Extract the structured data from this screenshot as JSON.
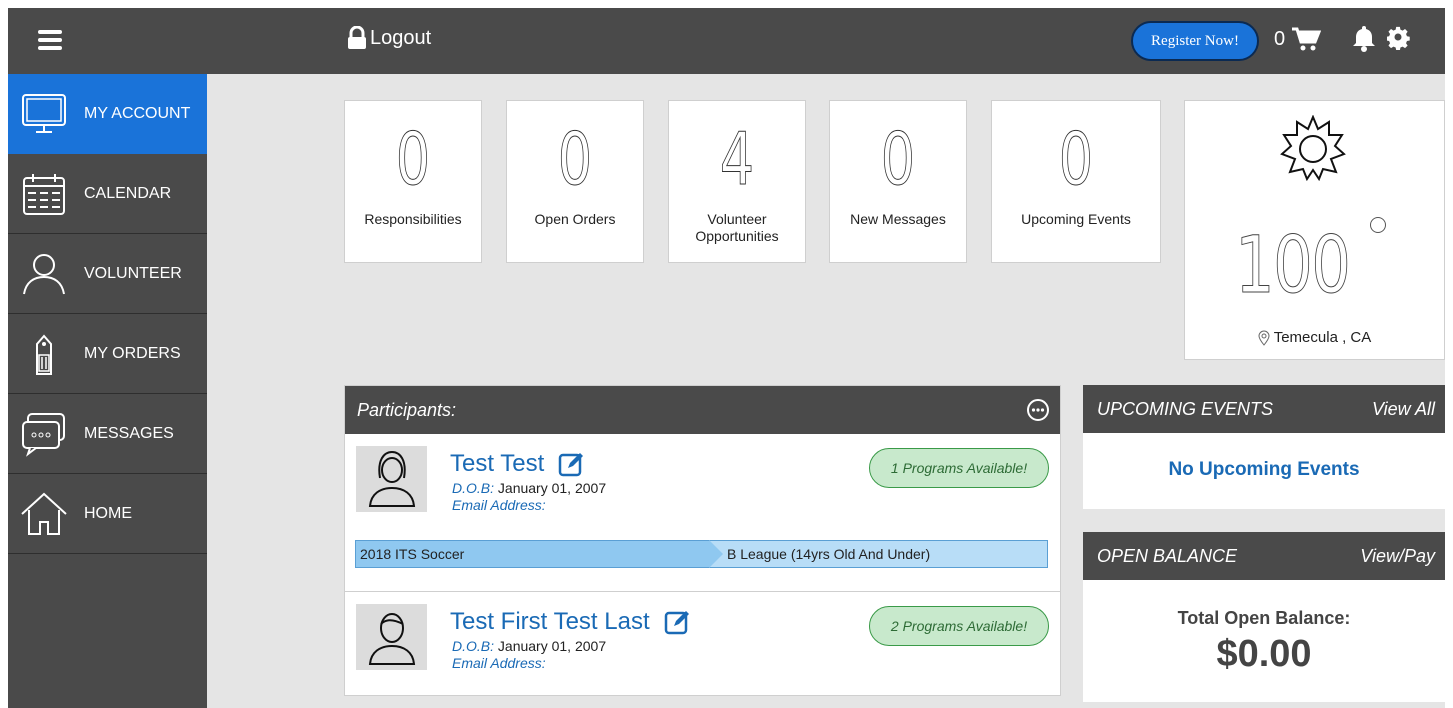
{
  "header": {
    "logout_label": "Logout",
    "register_label": "Register Now!",
    "cart_count": "0"
  },
  "sidebar": {
    "items": [
      {
        "label": "MY ACCOUNT",
        "icon": "monitor-icon",
        "active": true
      },
      {
        "label": "CALENDAR",
        "icon": "calendar-icon"
      },
      {
        "label": "VOLUNTEER",
        "icon": "person-icon"
      },
      {
        "label": "MY ORDERS",
        "icon": "tag-icon"
      },
      {
        "label": "MESSAGES",
        "icon": "chat-icon"
      },
      {
        "label": "HOME",
        "icon": "home-icon"
      }
    ]
  },
  "stats": [
    {
      "value": "0",
      "label": "Responsibilities"
    },
    {
      "value": "0",
      "label": "Open Orders"
    },
    {
      "value": "4",
      "label": "Volunteer Opportunities"
    },
    {
      "value": "0",
      "label": "New Messages"
    },
    {
      "value": "0",
      "label": "Upcoming Events"
    }
  ],
  "weather": {
    "temperature": "100",
    "location": "Temecula , CA",
    "icon": "sun-icon"
  },
  "participants": {
    "title": "Participants:",
    "list": [
      {
        "name": "Test Test",
        "dob_label": "D.O.B:",
        "dob": "January 01, 2007",
        "email_label": "Email Address:",
        "programs": "1 Programs Available!",
        "program_name": "2018 ITS Soccer",
        "division": "B League (14yrs Old And Under)"
      },
      {
        "name": "Test First Test Last",
        "dob_label": "D.O.B:",
        "dob": "January 01, 2007",
        "email_label": "Email Address:",
        "programs": "2 Programs Available!"
      }
    ]
  },
  "upcoming_events": {
    "title": "UPCOMING EVENTS",
    "link": "View All",
    "empty": "No Upcoming Events"
  },
  "open_balance": {
    "title": "OPEN BALANCE",
    "link": "View/Pay",
    "label": "Total Open Balance:",
    "value": "$0.00"
  },
  "colors": {
    "topbar": "#4a4a4a",
    "accent": "#1a73d9",
    "link": "#1a6ab5",
    "badge_bg": "#c8e9cc"
  }
}
